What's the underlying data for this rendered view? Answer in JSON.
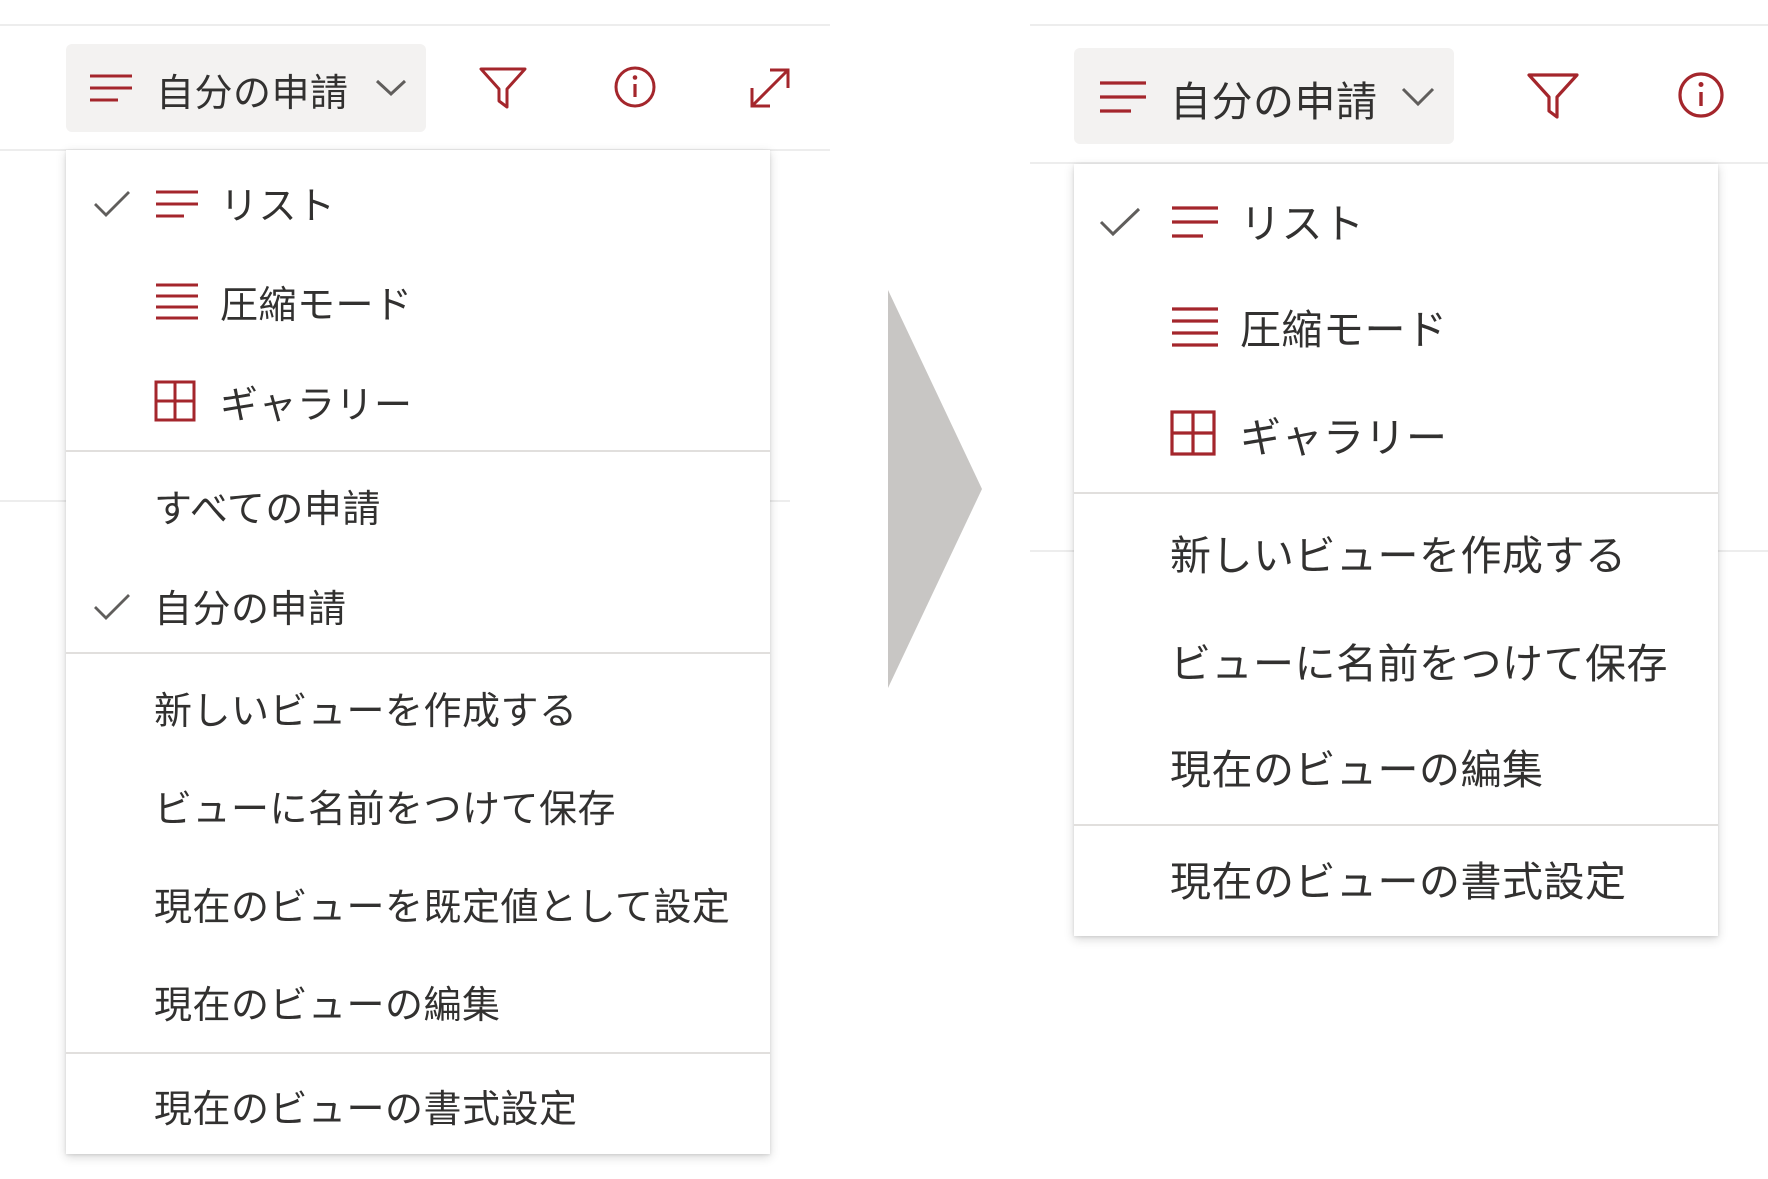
{
  "colors": {
    "accent": "#a4262c",
    "text": "#323130",
    "check": "#605e5c",
    "button_bg": "#f3f2f1",
    "arrow": "#c8c6c4"
  },
  "icons": {
    "view_icon": "list-lines-icon",
    "check": "checkmark-icon",
    "list": "list-lines-icon",
    "compact": "compact-lines-icon",
    "gallery": "grid-icon",
    "filter": "filter-funnel-icon",
    "info": "info-circle-icon",
    "expand": "expand-diagonal-icon",
    "dropdown": "chevron-down-icon",
    "transition": "right-chevron-arrow"
  },
  "left": {
    "toolbar": {
      "view_label": "自分の申請"
    },
    "menu": {
      "layout_items": [
        {
          "label": "リスト",
          "checked": true
        },
        {
          "label": "圧縮モード",
          "checked": false
        },
        {
          "label": "ギャラリー",
          "checked": false
        }
      ],
      "view_items": [
        {
          "label": "すべての申請",
          "checked": false
        },
        {
          "label": "自分の申請",
          "checked": true
        }
      ],
      "action_items": [
        {
          "label": "新しいビューを作成する"
        },
        {
          "label": "ビューに名前をつけて保存"
        },
        {
          "label": "現在のビューを既定値として設定"
        },
        {
          "label": "現在のビューの編集"
        }
      ],
      "format_items": [
        {
          "label": "現在のビューの書式設定"
        }
      ]
    }
  },
  "right": {
    "toolbar": {
      "view_label": "自分の申請"
    },
    "menu": {
      "layout_items": [
        {
          "label": "リスト",
          "checked": true
        },
        {
          "label": "圧縮モード",
          "checked": false
        },
        {
          "label": "ギャラリー",
          "checked": false
        }
      ],
      "action_items": [
        {
          "label": "新しいビューを作成する"
        },
        {
          "label": "ビューに名前をつけて保存"
        },
        {
          "label": "現在のビューの編集"
        }
      ],
      "format_items": [
        {
          "label": "現在のビューの書式設定"
        }
      ]
    }
  }
}
